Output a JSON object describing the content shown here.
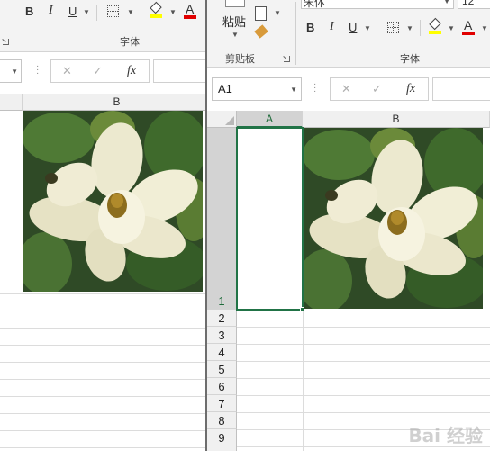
{
  "left_window": {
    "ribbon": {
      "bold": "B",
      "italic": "I",
      "underline": "U",
      "font_color_letter": "A",
      "group_font_label": "字体"
    },
    "formula_bar": {
      "fx": "fx"
    },
    "grid": {
      "column_b": "B"
    }
  },
  "right_window": {
    "ribbon": {
      "paste_label": "粘贴",
      "clipboard_label": "剪贴板",
      "font_name": "宋体",
      "font_size": "12",
      "bold": "B",
      "italic": "I",
      "underline": "U",
      "font_color_letter": "A",
      "group_font_label": "字体"
    },
    "formula_bar": {
      "name_box": "A1",
      "fx": "fx"
    },
    "grid": {
      "column_a": "A",
      "column_b": "B",
      "rows": [
        "1",
        "2",
        "3",
        "4",
        "5",
        "6",
        "7",
        "8",
        "9"
      ]
    }
  },
  "colors": {
    "accent_green": "#217346",
    "fill_yellow": "#ffff00",
    "font_red": "#e00000"
  },
  "watermark": "Bai 经验"
}
